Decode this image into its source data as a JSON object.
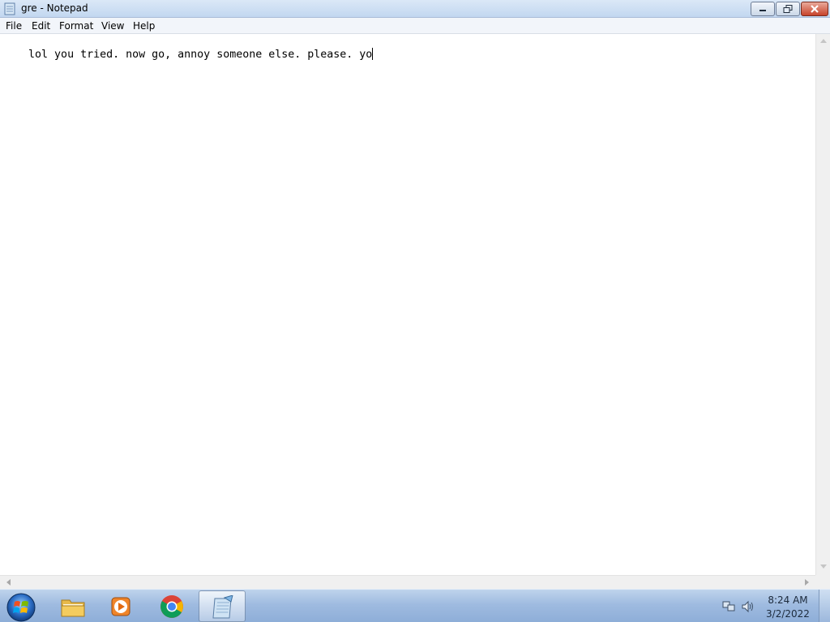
{
  "window": {
    "title": "gre - Notepad"
  },
  "menu": {
    "items": [
      "File",
      "Edit",
      "Format",
      "View",
      "Help"
    ]
  },
  "editor": {
    "text": "lol you tried. now go, annoy someone else. please. yo"
  },
  "taskbar": {
    "pinned": [
      {
        "name": "windows-explorer",
        "icon": "folder-icon"
      },
      {
        "name": "media-player",
        "icon": "media-player-icon"
      },
      {
        "name": "chrome",
        "icon": "chrome-icon"
      },
      {
        "name": "notepad",
        "icon": "notepad-icon",
        "active": true
      }
    ],
    "clock": {
      "time": "8:24 AM",
      "date": "3/2/2022"
    }
  },
  "colors": {
    "titlebar": "#c2d7f0",
    "taskbar": "#9fbbe0",
    "close": "#c7432b",
    "menubar": "#f2f5fa"
  }
}
